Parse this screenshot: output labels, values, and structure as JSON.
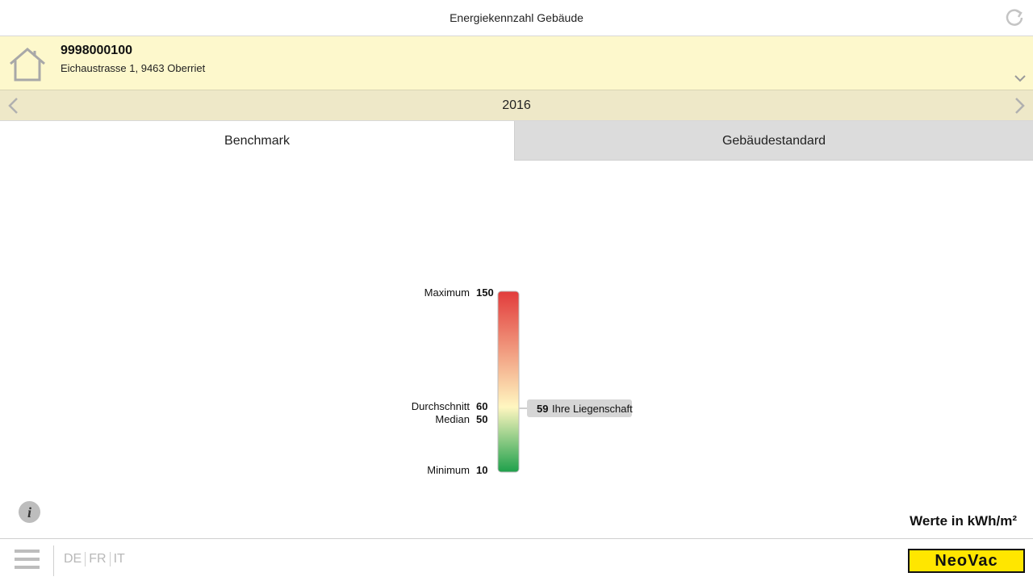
{
  "header": {
    "title": "Energiekennzahl Gebäude"
  },
  "property": {
    "id": "9998000100",
    "address": "Eichaustrasse 1, 9463 Oberriet"
  },
  "year_nav": {
    "year": "2016"
  },
  "tabs": [
    {
      "label": "Benchmark",
      "active": true
    },
    {
      "label": "Gebäudestandard",
      "active": false
    }
  ],
  "chart_data": {
    "type": "gradient-scale",
    "scale_min": 10,
    "scale_max": 150,
    "labels": [
      {
        "name": "Maximum",
        "value": 150
      },
      {
        "name": "Durchschnitt",
        "value": 60
      },
      {
        "name": "Median",
        "value": 50
      },
      {
        "name": "Minimum",
        "value": 10
      }
    ],
    "marker": {
      "value": 59,
      "label": "Ihre Liegenschaft"
    },
    "colors": {
      "high": "#e23b3b",
      "mid": "#fff6c0",
      "low": "#1ea04b"
    }
  },
  "units_label": "Werte in kWh/m²",
  "footer": {
    "languages": [
      "DE",
      "FR",
      "IT"
    ],
    "logo_text": "NeoVac"
  },
  "icons": {
    "refresh": "refresh-icon",
    "house": "house-icon",
    "dropdown": "chevron-down-icon",
    "prev": "chevron-left-icon",
    "next": "chevron-right-icon",
    "info": "info-icon",
    "menu": "menu-icon"
  }
}
